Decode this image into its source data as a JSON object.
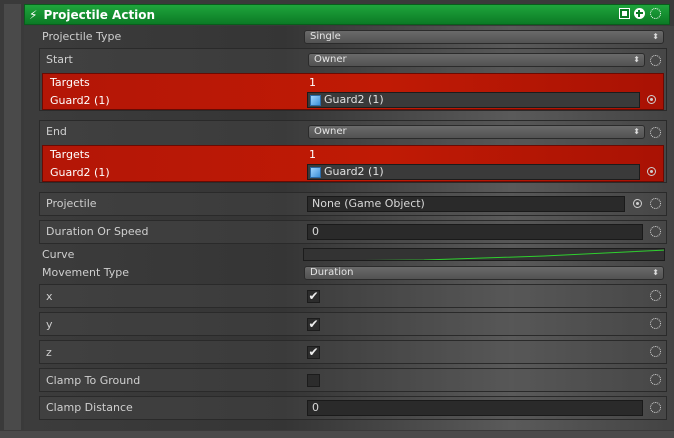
{
  "header": {
    "title": "Projectile Action"
  },
  "projectile_type": {
    "label": "Projectile Type",
    "value": "Single"
  },
  "start": {
    "label": "Start",
    "value": "Owner",
    "targets_label": "Targets",
    "targets_count": "1",
    "item_label": "Guard2 (1)",
    "item_value": "Guard2 (1)"
  },
  "end": {
    "label": "End",
    "value": "Owner",
    "targets_label": "Targets",
    "targets_count": "1",
    "item_label": "Guard2 (1)",
    "item_value": "Guard2 (1)"
  },
  "projectile": {
    "label": "Projectile",
    "value": "None (Game Object)"
  },
  "duration_or_speed": {
    "label": "Duration Or Speed",
    "value": "0"
  },
  "curve": {
    "label": "Curve"
  },
  "movement_type": {
    "label": "Movement Type",
    "value": "Duration"
  },
  "x": {
    "label": "x",
    "checked": true
  },
  "y": {
    "label": "y",
    "checked": true
  },
  "z": {
    "label": "z",
    "checked": true
  },
  "clamp_to_ground": {
    "label": "Clamp To Ground",
    "checked": false
  },
  "clamp_distance": {
    "label": "Clamp Distance",
    "value": "0"
  },
  "colors": {
    "header": "#12922f",
    "target_box": "#b71705",
    "curve": "#2fd02f"
  },
  "icons": {
    "header": "lightning-icon",
    "reset": "reset-circle-icon",
    "picker": "object-picker-icon",
    "object": "cube-icon"
  }
}
